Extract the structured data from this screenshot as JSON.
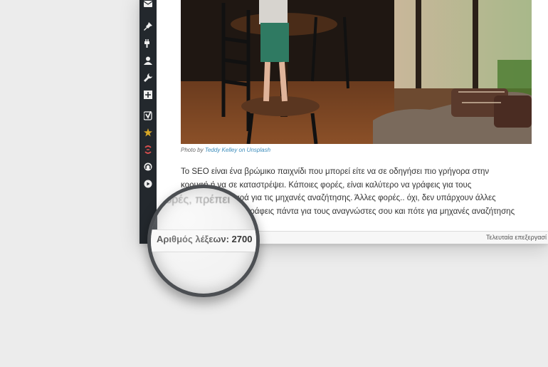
{
  "sidebar": {
    "icons": [
      "mail-icon",
      "pin-icon",
      "plugin-icon",
      "user-icon",
      "wrench-icon",
      "plus-box-icon",
      "yoast-icon",
      "star-icon",
      "swirl-icon",
      "circle-logo-icon",
      "play-icon"
    ]
  },
  "editor": {
    "photo_caption": {
      "prefix": "Photo by",
      "link": "Teddy Kelley on Unsplash"
    },
    "paragraph_lines": [
      "Το SEO είναι ένα βρώμικο παιχνίδι που μπορεί είτε να σε οδηγήσει πιο γρήγορα στην",
      "κορυφή ή να σε καταστρέψει. Κάποιες φορές, είναι καλύτερο να γράφεις για τους",
      "αναγνώστες, παρά για τις μηχανές αναζήτησης. Άλλες φορές.. όχι, δεν υπάρχουν άλλες",
      "φορές, πρέπει να γράφεις πάντα για τους αναγνώστες σου και πότε για μηχανές αναζήτησης"
    ]
  },
  "status": {
    "word_count": "Αριθμός λέξεων: 2700",
    "last_edited": "Τελευταία επεξεργασί",
    "magnified_fragment": "φορές, πρέπει"
  },
  "colors": {
    "sidebar": "#23282d",
    "link": "#3c8dbc",
    "star": "#d8a726",
    "swirl": "#d64e4e"
  }
}
